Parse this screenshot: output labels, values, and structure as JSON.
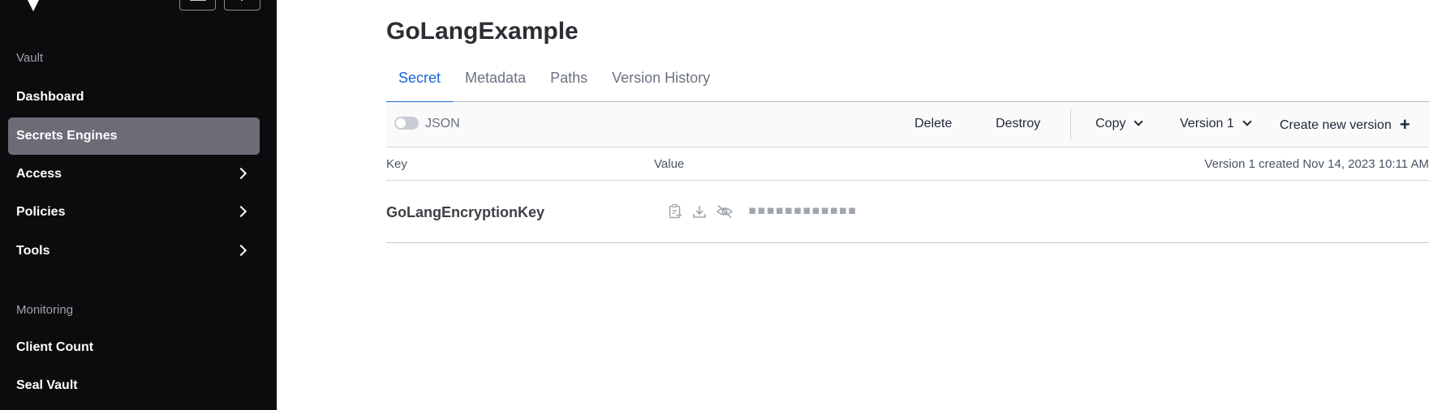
{
  "sidebar": {
    "section_vault": "Vault",
    "section_monitoring": "Monitoring",
    "items": [
      {
        "label": "Dashboard"
      },
      {
        "label": "Secrets Engines"
      },
      {
        "label": "Access"
      },
      {
        "label": "Policies"
      },
      {
        "label": "Tools"
      },
      {
        "label": "Client Count"
      },
      {
        "label": "Seal Vault"
      }
    ]
  },
  "page": {
    "title": "GoLangExample"
  },
  "tabs": [
    {
      "label": "Secret"
    },
    {
      "label": "Metadata"
    },
    {
      "label": "Paths"
    },
    {
      "label": "Version History"
    }
  ],
  "toolbar": {
    "json_label": "JSON",
    "delete_label": "Delete",
    "destroy_label": "Destroy",
    "copy_label": "Copy",
    "version_label": "Version 1",
    "create_label": "Create new version"
  },
  "table": {
    "col_key": "Key",
    "col_value": "Value",
    "meta": "Version 1 created Nov 14, 2023 10:11 AM",
    "rows": [
      {
        "key": "GoLangEncryptionKey",
        "masked_value": "▪▪▪▪▪▪▪▪▪▪▪▪"
      }
    ]
  },
  "colors": {
    "sidebar_bg": "#0c0c0e",
    "active_nav": "#6b6c76",
    "accent": "#1c64d8"
  },
  "icons": {
    "copy": "clipboard-copy-icon",
    "download": "download-icon",
    "reveal": "eye-off-icon"
  }
}
